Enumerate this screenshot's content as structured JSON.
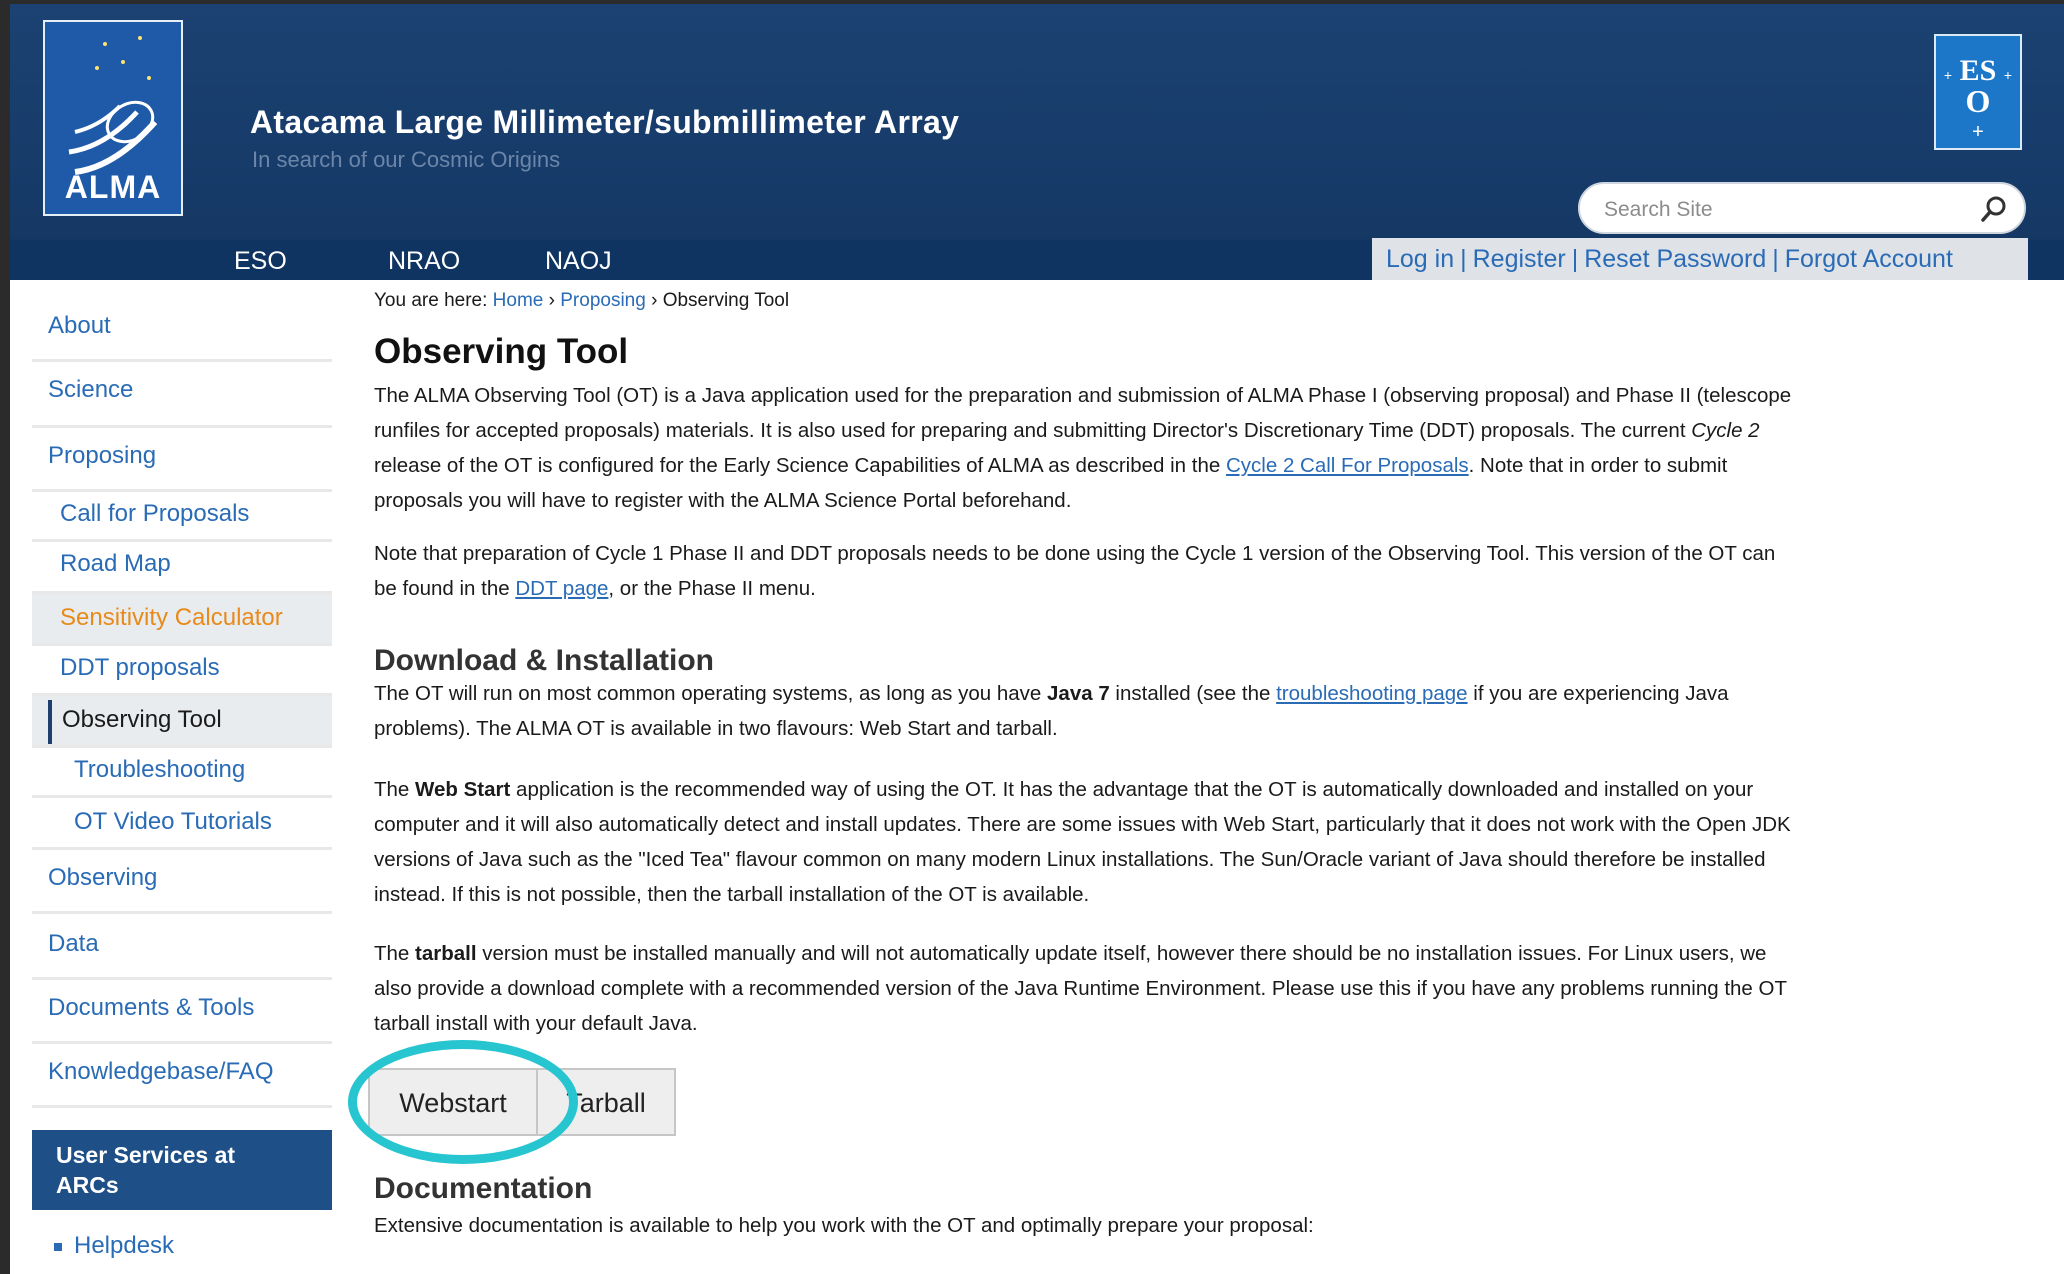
{
  "header": {
    "logo_text": "ALMA",
    "title": "Atacama Large Millimeter/submillimeter Array",
    "subtitle": "In search of our Cosmic Origins",
    "search_placeholder": "Search Site"
  },
  "nav": [
    "ESO",
    "NRAO",
    "NAOJ"
  ],
  "account": [
    "Log in",
    "Register",
    "Reset Password",
    "Forgot Account"
  ],
  "sidebar": {
    "items": [
      "About",
      "Science",
      "Proposing",
      "Call for Proposals",
      "Road Map",
      "Sensitivity Calculator",
      "DDT proposals",
      "Observing Tool",
      "Troubleshooting",
      "OT Video Tutorials",
      "Observing",
      "Data",
      "Documents & Tools",
      "Knowledgebase/FAQ"
    ],
    "arc_box": [
      "User Services at",
      "ARCs"
    ],
    "helpdesk": "Helpdesk"
  },
  "breadcrumb": {
    "prefix": "You are here:",
    "home": "Home",
    "proposing": "Proposing",
    "current": "Observing Tool"
  },
  "main": {
    "title": "Observing Tool",
    "p1": [
      "The ALMA Observing Tool (OT) is a Java application used for the preparation and submission of ALMA Phase I (observing proposal) and Phase II (telescope",
      "runfiles for accepted proposals) materials. It is also used for preparing and submitting Director's Discretionary Time (DDT) proposals. The current ",
      "Cycle 2",
      "release of the OT is configured for the Early Science Capabilities of ALMA as described in the ",
      "Cycle 2 Call For Proposals",
      ". Note that in order to submit",
      "proposals you will have to register with the ALMA Science Portal beforehand."
    ],
    "p2": [
      "Note that preparation of Cycle 1 Phase II and DDT proposals needs to be done using the Cycle 1 version of the Observing Tool. This version of the OT can",
      "be found in the ",
      "DDT page",
      ", or the Phase II menu."
    ],
    "download_heading": "Download & Installation",
    "p3": [
      "The OT will run on most common operating systems, as long as you have ",
      "Java 7",
      " installed (see the ",
      "troubleshooting page",
      " if you are experiencing Java",
      "problems). The ALMA OT is available in two flavours: Web Start and tarball."
    ],
    "p4": [
      "The ",
      "Web Start",
      " application is the recommended way of using the OT. It has the advantage that the OT is automatically downloaded and installed on your",
      "computer and it will also automatically detect and install updates. There are some issues with Web Start, particularly that it does not work with the Open JDK",
      "versions of Java such as the \"Iced Tea\" flavour common on many modern Linux installations. The Sun/Oracle variant of Java should therefore be installed",
      "instead. If this is not possible, then the tarball installation of the OT is available."
    ],
    "p5": [
      "The ",
      "tarball",
      " version must be installed manually and will not automatically update itself, however there should be no installation issues. For Linux users, we",
      "also provide a download complete with a recommended version of the Java Runtime Environment. Please use this if you have any problems running the OT",
      "tarball install with your default Java."
    ],
    "buttons": [
      "Webstart",
      "Tarball"
    ],
    "documentation_heading": "Documentation",
    "p6": "Extensive documentation is available to help you work with the OT and optimally prepare your proposal:"
  },
  "colors": {
    "header_bg": "#173c6b",
    "link": "#2a6bb6",
    "highlight_ring": "#27c5d0",
    "active_sidebar": "#e88a1a"
  }
}
